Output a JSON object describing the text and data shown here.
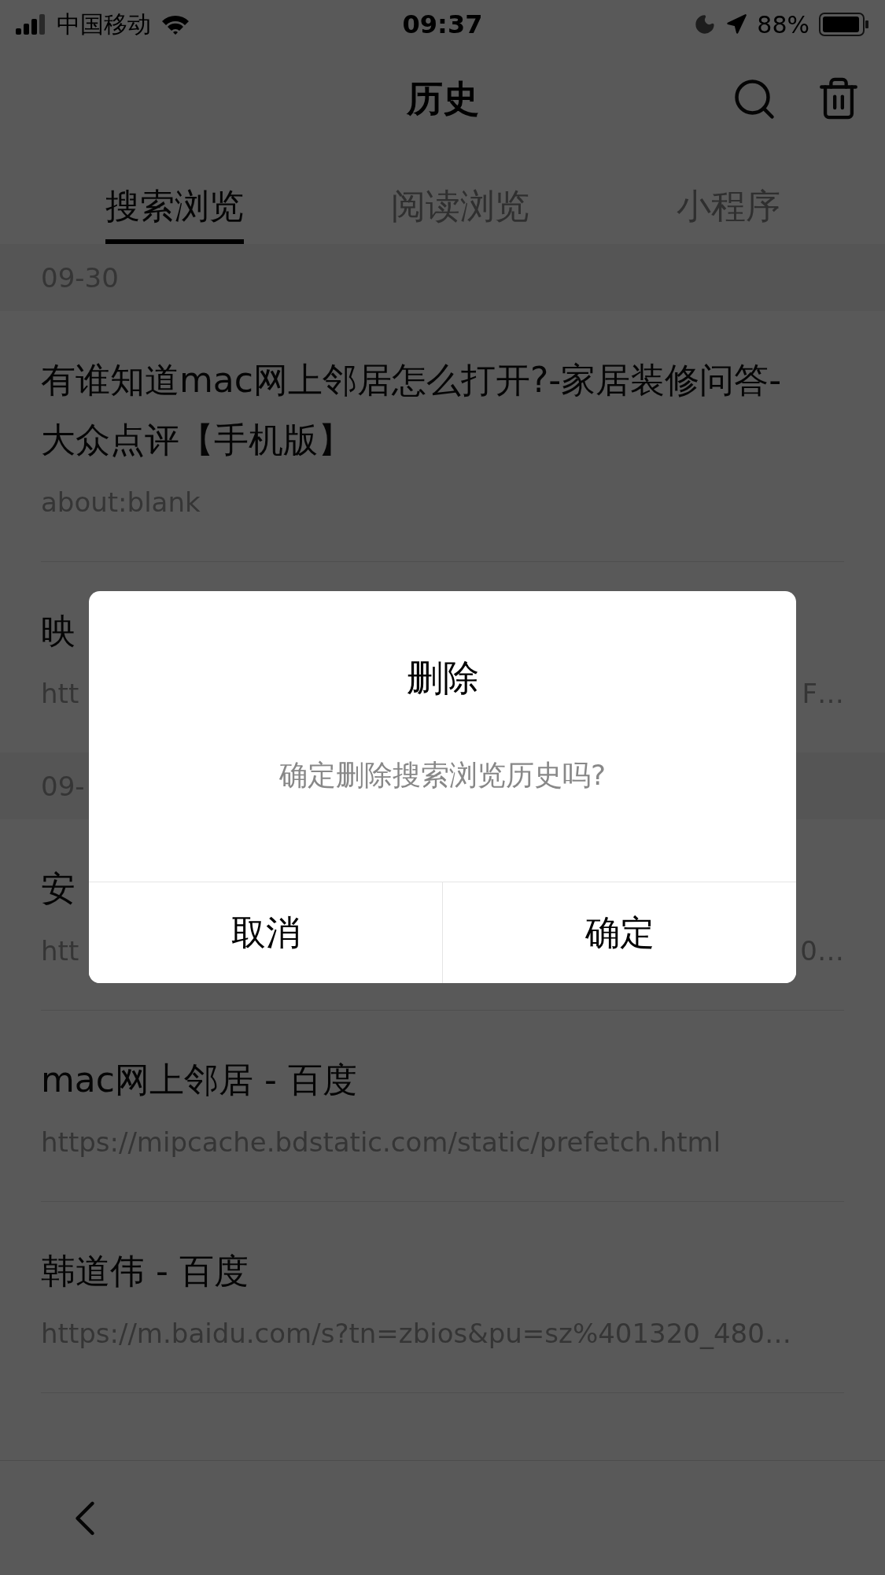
{
  "status_bar": {
    "carrier": "中国移动",
    "time": "09:37",
    "battery": "88%"
  },
  "nav": {
    "title": "历史"
  },
  "tabs": [
    {
      "label": "搜索浏览",
      "selected": true
    },
    {
      "label": "阅读浏览",
      "selected": false
    },
    {
      "label": "小程序",
      "selected": false
    }
  ],
  "sections": [
    {
      "date": "09-30",
      "items": [
        {
          "title": "有谁知道mac网上邻居怎么打开?-家居装修问答-大众点评【手机版】",
          "url": "about:blank"
        },
        {
          "title": "映",
          "url": "htt",
          "url_end": "F…"
        }
      ]
    },
    {
      "date": "09-",
      "items": [
        {
          "title": "安",
          "url": "htt",
          "url_end": "0…"
        },
        {
          "title": "mac网上邻居 - 百度",
          "url": "https://mipcache.bdstatic.com/static/prefetch.html"
        },
        {
          "title": "韩道伟 - 百度",
          "url": "https://m.baidu.com/s?tn=zbios&pu=sz%401320_480…"
        }
      ]
    }
  ],
  "dialog": {
    "title": "删除",
    "message": "确定删除搜索浏览历史吗?",
    "buttons": [
      "取消",
      "确定"
    ]
  }
}
